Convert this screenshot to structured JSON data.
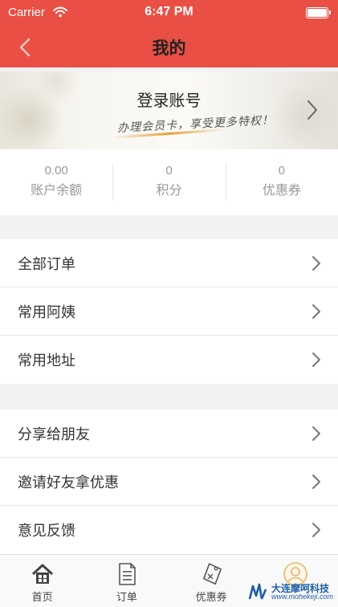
{
  "status_bar": {
    "carrier": "Carrier",
    "time": "6:47 PM"
  },
  "nav": {
    "title": "我的"
  },
  "banner": {
    "login_label": "登录账号",
    "slogan": "办理会员卡，享受更多特权！"
  },
  "stats": [
    {
      "value": "0.00",
      "label": "账户余额"
    },
    {
      "value": "0",
      "label": "积分"
    },
    {
      "value": "0",
      "label": "优惠券"
    }
  ],
  "menu_group_1": [
    {
      "label": "全部订单"
    },
    {
      "label": "常用阿姨"
    },
    {
      "label": "常用地址"
    }
  ],
  "menu_group_2": [
    {
      "label": "分享给朋友"
    },
    {
      "label": "邀请好友拿优惠"
    },
    {
      "label": "意见反馈"
    }
  ],
  "tabbar": [
    {
      "label": "首页",
      "icon": "home-icon"
    },
    {
      "label": "订单",
      "icon": "orders-icon"
    },
    {
      "label": "优惠券",
      "icon": "coupon-icon"
    },
    {
      "label": "",
      "icon": "profile-icon"
    }
  ],
  "watermark": {
    "name": "大连摩呵科技",
    "url": "www.mohekeji.com"
  },
  "colors": {
    "accent": "#e94f45",
    "text": "#333333",
    "muted": "#999999",
    "background": "#f2f2f2"
  }
}
